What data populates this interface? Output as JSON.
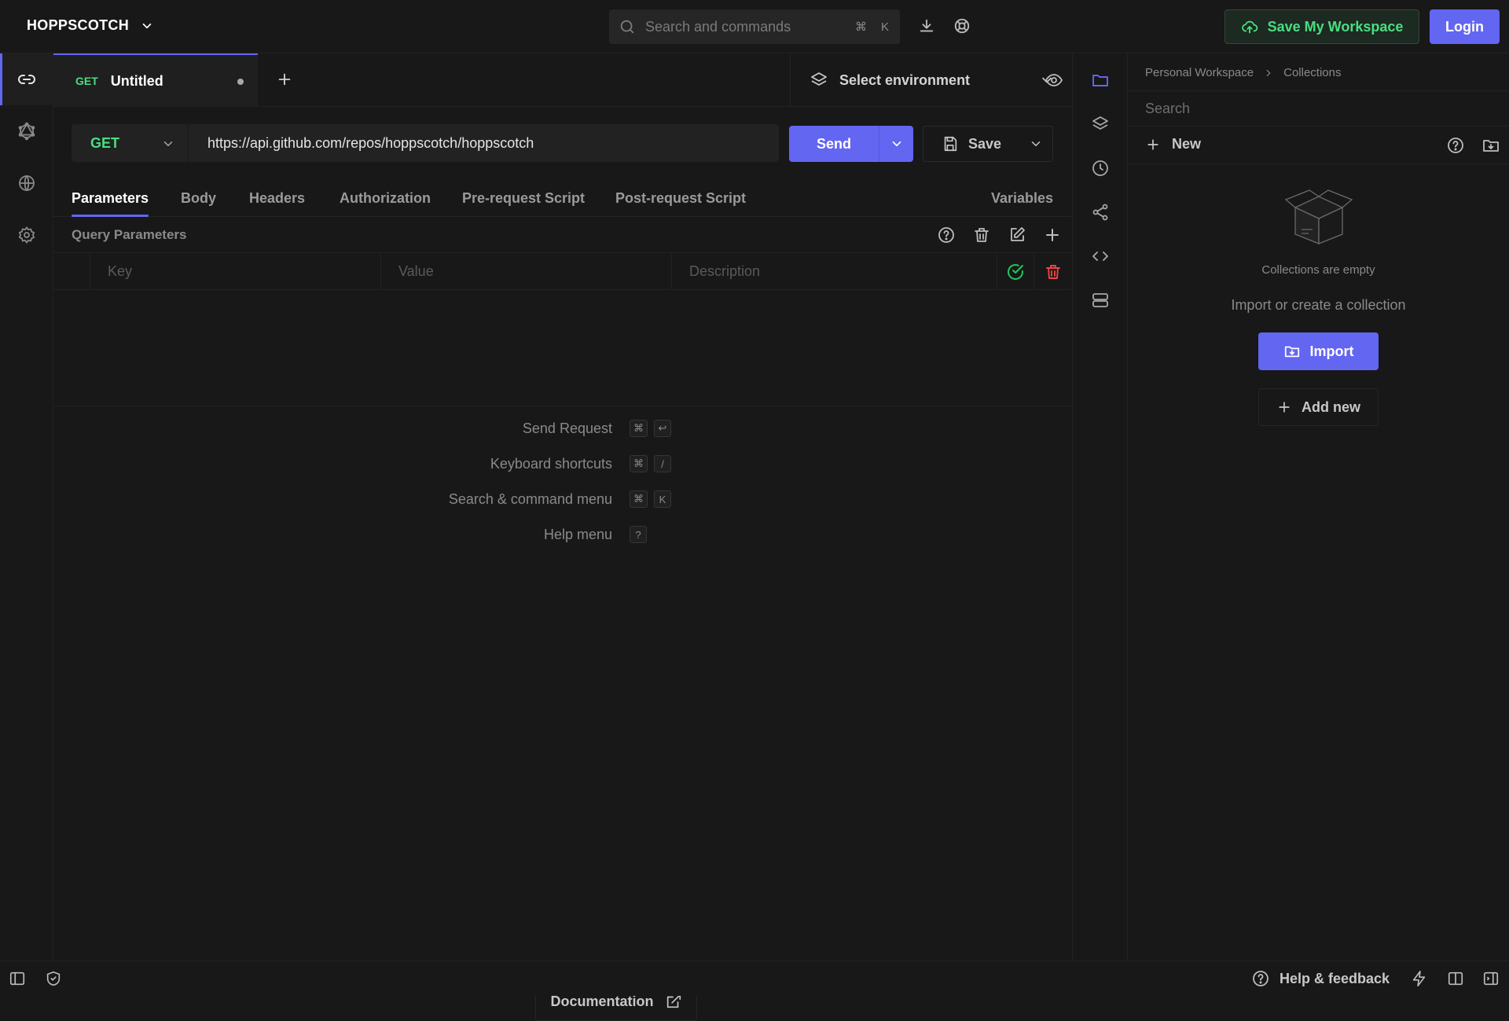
{
  "topbar": {
    "brand": "HOPPSCOTCH",
    "search_placeholder": "Search and commands",
    "search_keys": [
      "⌘",
      "K"
    ],
    "save_workspace_label": "Save My Workspace",
    "login_label": "Login"
  },
  "leftrail": {
    "items": [
      {
        "name": "rest",
        "icon": "link-icon",
        "active": true
      },
      {
        "name": "graphql",
        "icon": "graphql-icon",
        "active": false
      },
      {
        "name": "realtime",
        "icon": "globe-icon",
        "active": false
      },
      {
        "name": "settings",
        "icon": "gear-icon",
        "active": false
      }
    ]
  },
  "tabs": {
    "items": [
      {
        "method": "GET",
        "title": "Untitled",
        "unsaved": true
      }
    ],
    "environment_label": "Select environment"
  },
  "request": {
    "method": "GET",
    "url": "https://api.github.com/repos/hoppscotch/hoppscotch",
    "send_label": "Send",
    "save_label": "Save"
  },
  "request_tabs": {
    "items": [
      "Parameters",
      "Body",
      "Headers",
      "Authorization",
      "Pre-request Script",
      "Post-request Script"
    ],
    "active": "Parameters",
    "variables_label": "Variables"
  },
  "query_params": {
    "title": "Query Parameters",
    "columns": {
      "key": "Key",
      "value": "Value",
      "description": "Description"
    }
  },
  "shortcuts": {
    "items": [
      {
        "label": "Send Request",
        "keys": [
          "⌘",
          "↩"
        ]
      },
      {
        "label": "Keyboard shortcuts",
        "keys": [
          "⌘",
          "/"
        ]
      },
      {
        "label": "Search & command menu",
        "keys": [
          "⌘",
          "K"
        ]
      },
      {
        "label": "Help menu",
        "keys": [
          "?"
        ]
      }
    ],
    "documentation_label": "Documentation"
  },
  "collections_panel": {
    "breadcrumb": [
      "Personal Workspace",
      "Collections"
    ],
    "search_placeholder": "Search",
    "new_label": "New",
    "empty_title": "Collections are empty",
    "empty_subtitle": "Import or create a collection",
    "import_label": "Import",
    "add_new_label": "Add new"
  },
  "statusbar": {
    "help_label": "Help & feedback"
  },
  "colors": {
    "accent": "#6366f1",
    "method_get": "#4ade80",
    "background": "#181818",
    "danger": "#ef4444"
  }
}
